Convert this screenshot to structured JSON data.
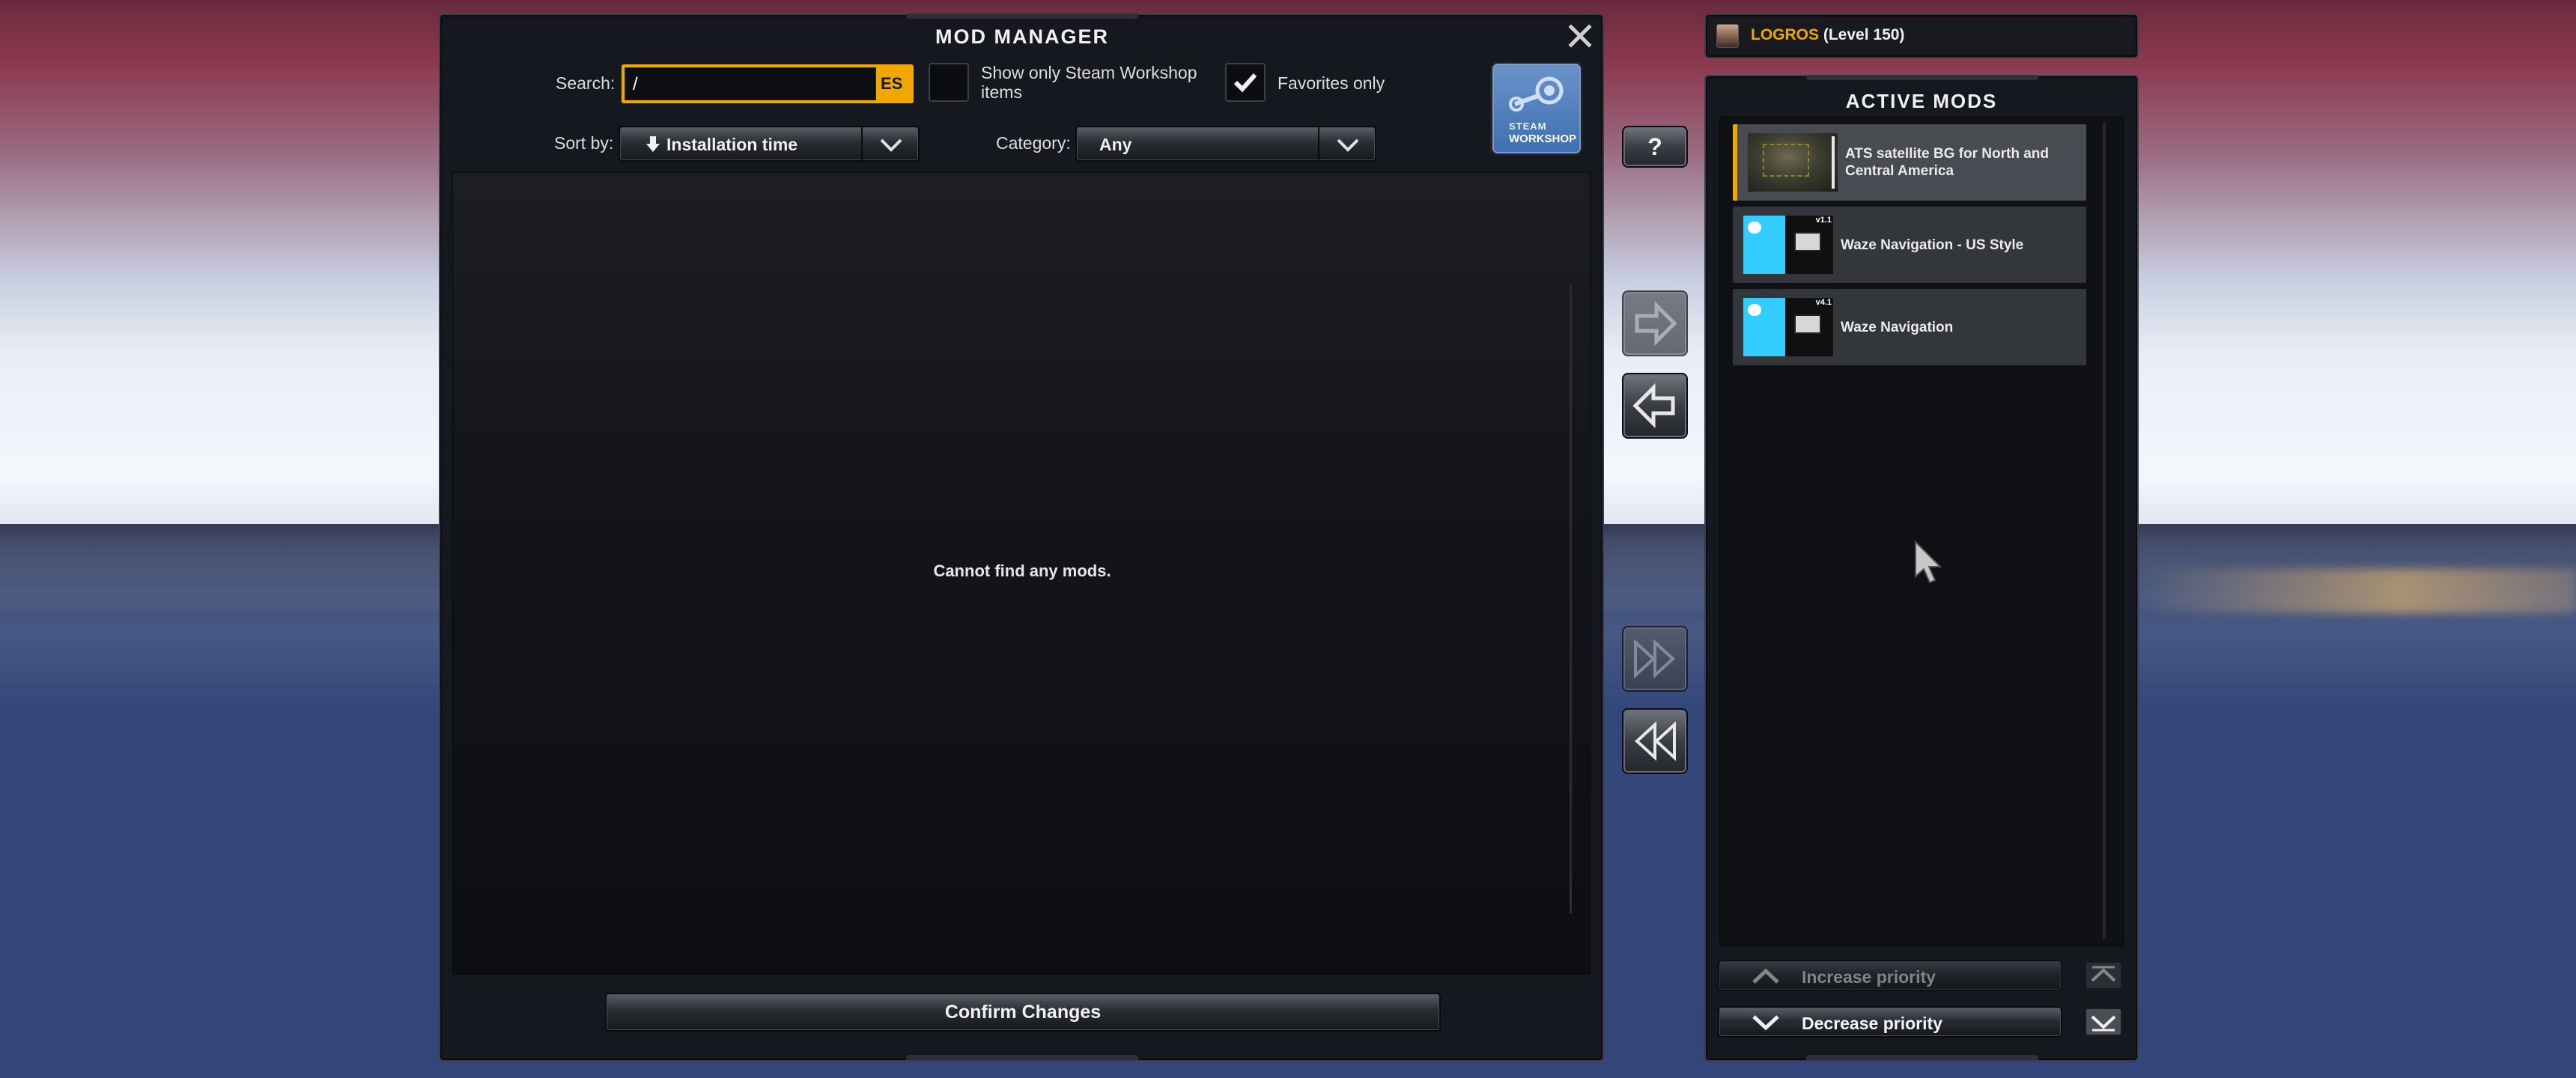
{
  "window": {
    "title": "MOD MANAGER",
    "search_label": "Search:",
    "search_value": "/",
    "search_lang": "ES",
    "workshop_only_label": "Show only Steam Workshop items",
    "favorites_label": "Favorites only",
    "sort_label": "Sort by:",
    "sort_value": "Installation time",
    "category_label": "Category:",
    "category_value": "Any",
    "empty_message": "Cannot find any mods.",
    "confirm_label": "Confirm Changes",
    "workshop_logo_line1": "STEAM",
    "workshop_logo_line2": "WORKSHOP"
  },
  "profile": {
    "name": "LOGROS",
    "level": "(Level 150)"
  },
  "active_mods": {
    "title": "ACTIVE MODS",
    "items": [
      {
        "name": "ATS satellite BG for North and Central America",
        "badge": ""
      },
      {
        "name": "Waze Navigation - US Style",
        "badge": "v1.1"
      },
      {
        "name": "Waze Navigation",
        "badge": "v4.1"
      }
    ],
    "increase_label": "Increase priority",
    "decrease_label": "Decrease priority"
  },
  "side_buttons": {
    "help": "?"
  },
  "colors": {
    "accent": "#f0a800",
    "panel": "#15181e",
    "waze": "#33ccff"
  },
  "icons": [
    "close-icon",
    "checkbox-icon",
    "checkmark-icon",
    "sort-down-arrow-icon",
    "chevron-down-icon",
    "arrow-right-icon",
    "arrow-left-icon",
    "double-arrow-right-icon",
    "double-arrow-left-icon",
    "chevron-up-icon",
    "mouse-cursor-icon"
  ]
}
